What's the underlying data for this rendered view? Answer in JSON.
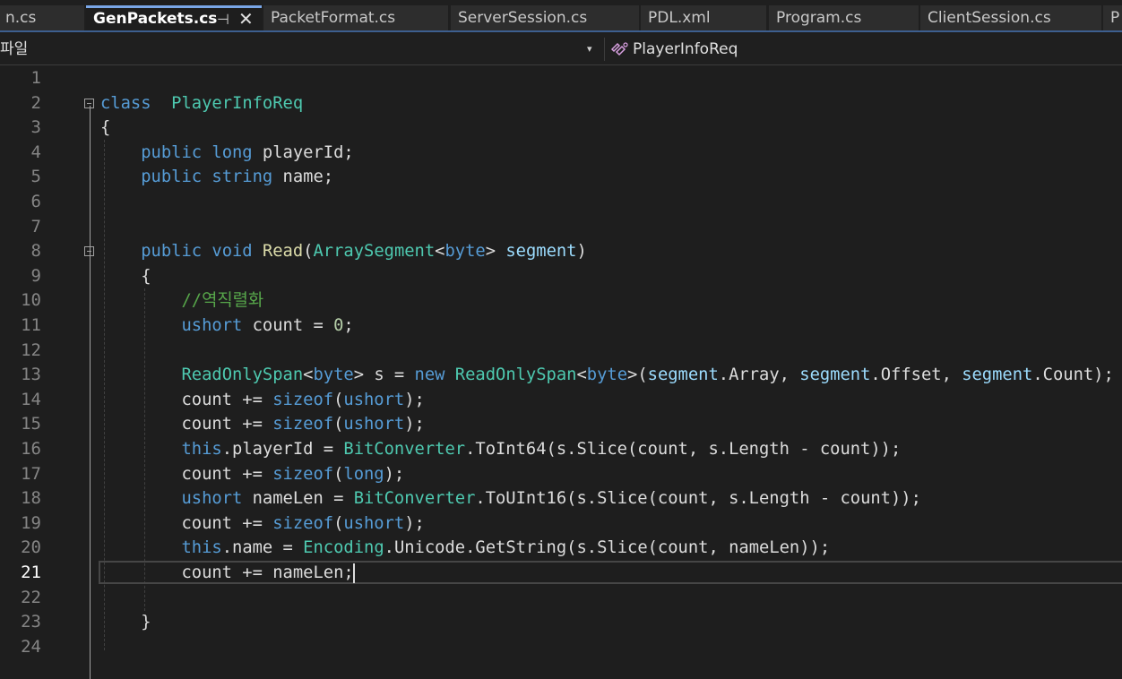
{
  "tabs": [
    {
      "label": "n.cs"
    },
    {
      "label": "GenPackets.cs",
      "active": true,
      "pin": "⊣",
      "close": "✕"
    },
    {
      "label": "PacketFormat.cs"
    },
    {
      "label": "ServerSession.cs"
    },
    {
      "label": "PDL.xml"
    },
    {
      "label": "Program.cs"
    },
    {
      "label": "ClientSession.cs"
    },
    {
      "label": "P"
    }
  ],
  "navbar": {
    "project": "파일",
    "dropdown_glyph": "▾",
    "member": "PlayerInfoReq",
    "member_icon": "class-icon"
  },
  "editor": {
    "current_line": 21,
    "line_numbers": [
      "1",
      "2",
      "3",
      "4",
      "5",
      "6",
      "7",
      "8",
      "9",
      "10",
      "11",
      "12",
      "13",
      "14",
      "15",
      "16",
      "17",
      "18",
      "19",
      "20",
      "21",
      "22",
      "23",
      "24"
    ],
    "lines": [
      [],
      [
        [
          "kw",
          "class"
        ],
        [
          "",
          "  "
        ],
        [
          "ty",
          "PlayerInfoReq"
        ]
      ],
      [
        [
          "",
          "{"
        ]
      ],
      [
        [
          "",
          "    "
        ],
        [
          "kw",
          "public"
        ],
        [
          "",
          " "
        ],
        [
          "kw",
          "long"
        ],
        [
          "",
          " playerId;"
        ]
      ],
      [
        [
          "",
          "    "
        ],
        [
          "kw",
          "public"
        ],
        [
          "",
          " "
        ],
        [
          "kw",
          "string"
        ],
        [
          "",
          " name;"
        ]
      ],
      [],
      [],
      [
        [
          "",
          "    "
        ],
        [
          "kw",
          "public"
        ],
        [
          "",
          " "
        ],
        [
          "kw",
          "void"
        ],
        [
          "",
          " "
        ],
        [
          "fn",
          "Read"
        ],
        [
          "",
          "("
        ],
        [
          "ty",
          "ArraySegment"
        ],
        [
          "",
          "<"
        ],
        [
          "kw",
          "byte"
        ],
        [
          "",
          "> "
        ],
        [
          "pm",
          "segment"
        ],
        [
          "",
          ")"
        ]
      ],
      [
        [
          "",
          "    {"
        ]
      ],
      [
        [
          "",
          "        "
        ],
        [
          "cm",
          "//역직렬화"
        ]
      ],
      [
        [
          "",
          "        "
        ],
        [
          "kw",
          "ushort"
        ],
        [
          "",
          " count = "
        ],
        [
          "nm",
          "0"
        ],
        [
          "",
          ";"
        ]
      ],
      [],
      [
        [
          "",
          "        "
        ],
        [
          "ty",
          "ReadOnlySpan"
        ],
        [
          "",
          "<"
        ],
        [
          "kw",
          "byte"
        ],
        [
          "",
          "> s = "
        ],
        [
          "kw",
          "new"
        ],
        [
          "",
          " "
        ],
        [
          "ty",
          "ReadOnlySpan"
        ],
        [
          "",
          "<"
        ],
        [
          "kw",
          "byte"
        ],
        [
          "",
          ">("
        ],
        [
          "pm",
          "segment"
        ],
        [
          "",
          ".Array, "
        ],
        [
          "pm",
          "segment"
        ],
        [
          "",
          ".Offset, "
        ],
        [
          "pm",
          "segment"
        ],
        [
          "",
          ".Count);"
        ]
      ],
      [
        [
          "",
          "        count += "
        ],
        [
          "kw",
          "sizeof"
        ],
        [
          "",
          "("
        ],
        [
          "kw",
          "ushort"
        ],
        [
          "",
          ");"
        ]
      ],
      [
        [
          "",
          "        count += "
        ],
        [
          "kw",
          "sizeof"
        ],
        [
          "",
          "("
        ],
        [
          "kw",
          "ushort"
        ],
        [
          "",
          ");"
        ]
      ],
      [
        [
          "",
          "        "
        ],
        [
          "kw",
          "this"
        ],
        [
          "",
          ".playerId = "
        ],
        [
          "ty",
          "BitConverter"
        ],
        [
          "",
          ".ToInt64(s.Slice(count, s.Length - count));"
        ]
      ],
      [
        [
          "",
          "        count += "
        ],
        [
          "kw",
          "sizeof"
        ],
        [
          "",
          "("
        ],
        [
          "kw",
          "long"
        ],
        [
          "",
          ");"
        ]
      ],
      [
        [
          "",
          "        "
        ],
        [
          "kw",
          "ushort"
        ],
        [
          "",
          " nameLen = "
        ],
        [
          "ty",
          "BitConverter"
        ],
        [
          "",
          ".ToUInt16(s.Slice(count, s.Length - count));"
        ]
      ],
      [
        [
          "",
          "        count += "
        ],
        [
          "kw",
          "sizeof"
        ],
        [
          "",
          "("
        ],
        [
          "kw",
          "ushort"
        ],
        [
          "",
          ");"
        ]
      ],
      [
        [
          "",
          "        "
        ],
        [
          "kw",
          "this"
        ],
        [
          "",
          ".name = "
        ],
        [
          "ty",
          "Encoding"
        ],
        [
          "",
          ".Unicode.GetString(s.Slice(count, nameLen));"
        ]
      ],
      [
        [
          "",
          "        count += nameLen;"
        ]
      ],
      [],
      [
        [
          "",
          "    }"
        ]
      ],
      []
    ]
  }
}
